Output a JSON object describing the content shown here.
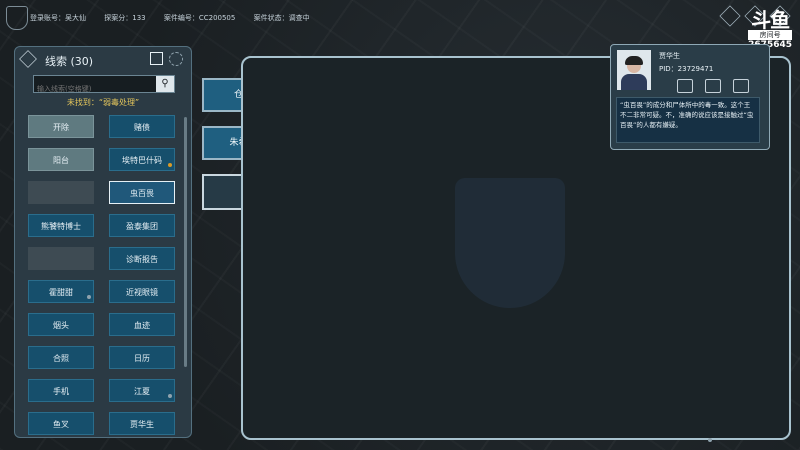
{
  "topbar": {
    "account_label": "登录账号：",
    "account": "吴大仙",
    "score_label": "探案分：",
    "score": "133",
    "case_label": "案件编号：",
    "case_no": "CC200505",
    "status_label": "案件状态：",
    "status": "调查中"
  },
  "streamer": {
    "logo": "斗鱼",
    "room_label": "房间号",
    "room_no": "2675645"
  },
  "clue_panel": {
    "title": "线索 (30)",
    "search_placeholder": "输入线索(空格键)",
    "not_found": "未找到：“弱毒处理”",
    "cells": [
      {
        "label": "开除",
        "state": "used"
      },
      {
        "label": "赌债",
        "state": "normal"
      },
      {
        "label": "阳台",
        "state": "used"
      },
      {
        "label": "埃特巴什码",
        "state": "normal",
        "marker": "pin"
      },
      {
        "label": "",
        "state": "empty"
      },
      {
        "label": "虫百畏",
        "state": "hover"
      },
      {
        "label": "熊饕特博士",
        "state": "normal"
      },
      {
        "label": "盈泰集团",
        "state": "normal"
      },
      {
        "label": "",
        "state": "empty"
      },
      {
        "label": "诊断报告",
        "state": "normal"
      },
      {
        "label": "霍甜甜",
        "state": "normal",
        "marker": "dot"
      },
      {
        "label": "近视眼镜",
        "state": "normal"
      },
      {
        "label": "烟头",
        "state": "normal"
      },
      {
        "label": "血迹",
        "state": "normal"
      },
      {
        "label": "合照",
        "state": "normal"
      },
      {
        "label": "日历",
        "state": "normal"
      },
      {
        "label": "手机",
        "state": "normal"
      },
      {
        "label": "江夏",
        "state": "normal",
        "marker": "dot"
      },
      {
        "label": "鱼叉",
        "state": "normal"
      },
      {
        "label": "贾华生",
        "state": "normal"
      }
    ]
  },
  "board_cards": [
    {
      "label": "仓库"
    },
    {
      "label": "朱希祥"
    },
    {
      "label": ""
    }
  ],
  "character": {
    "name": "贾华生",
    "pid": "PID：23729471",
    "desc": "“虫百畏”的成分和尸体所中的毒一致。这个王不二非常可疑。不，准确的说应该是接触过“虫百畏”的人都有嫌疑。"
  }
}
